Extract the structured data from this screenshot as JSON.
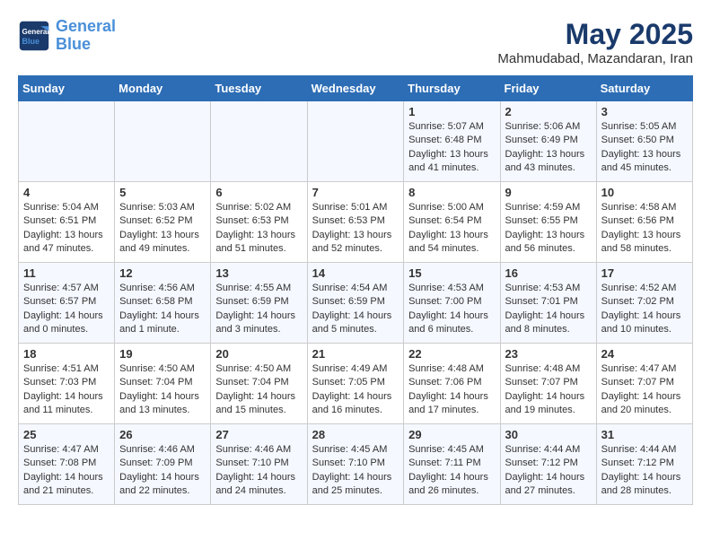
{
  "header": {
    "logo_line1": "General",
    "logo_line2": "Blue",
    "title": "May 2025",
    "subtitle": "Mahmudabad, Mazandaran, Iran"
  },
  "days_of_week": [
    "Sunday",
    "Monday",
    "Tuesday",
    "Wednesday",
    "Thursday",
    "Friday",
    "Saturday"
  ],
  "weeks": [
    [
      {
        "day": "",
        "info": ""
      },
      {
        "day": "",
        "info": ""
      },
      {
        "day": "",
        "info": ""
      },
      {
        "day": "",
        "info": ""
      },
      {
        "day": "1",
        "info": "Sunrise: 5:07 AM\nSunset: 6:48 PM\nDaylight: 13 hours and 41 minutes."
      },
      {
        "day": "2",
        "info": "Sunrise: 5:06 AM\nSunset: 6:49 PM\nDaylight: 13 hours and 43 minutes."
      },
      {
        "day": "3",
        "info": "Sunrise: 5:05 AM\nSunset: 6:50 PM\nDaylight: 13 hours and 45 minutes."
      }
    ],
    [
      {
        "day": "4",
        "info": "Sunrise: 5:04 AM\nSunset: 6:51 PM\nDaylight: 13 hours and 47 minutes."
      },
      {
        "day": "5",
        "info": "Sunrise: 5:03 AM\nSunset: 6:52 PM\nDaylight: 13 hours and 49 minutes."
      },
      {
        "day": "6",
        "info": "Sunrise: 5:02 AM\nSunset: 6:53 PM\nDaylight: 13 hours and 51 minutes."
      },
      {
        "day": "7",
        "info": "Sunrise: 5:01 AM\nSunset: 6:53 PM\nDaylight: 13 hours and 52 minutes."
      },
      {
        "day": "8",
        "info": "Sunrise: 5:00 AM\nSunset: 6:54 PM\nDaylight: 13 hours and 54 minutes."
      },
      {
        "day": "9",
        "info": "Sunrise: 4:59 AM\nSunset: 6:55 PM\nDaylight: 13 hours and 56 minutes."
      },
      {
        "day": "10",
        "info": "Sunrise: 4:58 AM\nSunset: 6:56 PM\nDaylight: 13 hours and 58 minutes."
      }
    ],
    [
      {
        "day": "11",
        "info": "Sunrise: 4:57 AM\nSunset: 6:57 PM\nDaylight: 14 hours and 0 minutes."
      },
      {
        "day": "12",
        "info": "Sunrise: 4:56 AM\nSunset: 6:58 PM\nDaylight: 14 hours and 1 minute."
      },
      {
        "day": "13",
        "info": "Sunrise: 4:55 AM\nSunset: 6:59 PM\nDaylight: 14 hours and 3 minutes."
      },
      {
        "day": "14",
        "info": "Sunrise: 4:54 AM\nSunset: 6:59 PM\nDaylight: 14 hours and 5 minutes."
      },
      {
        "day": "15",
        "info": "Sunrise: 4:53 AM\nSunset: 7:00 PM\nDaylight: 14 hours and 6 minutes."
      },
      {
        "day": "16",
        "info": "Sunrise: 4:53 AM\nSunset: 7:01 PM\nDaylight: 14 hours and 8 minutes."
      },
      {
        "day": "17",
        "info": "Sunrise: 4:52 AM\nSunset: 7:02 PM\nDaylight: 14 hours and 10 minutes."
      }
    ],
    [
      {
        "day": "18",
        "info": "Sunrise: 4:51 AM\nSunset: 7:03 PM\nDaylight: 14 hours and 11 minutes."
      },
      {
        "day": "19",
        "info": "Sunrise: 4:50 AM\nSunset: 7:04 PM\nDaylight: 14 hours and 13 minutes."
      },
      {
        "day": "20",
        "info": "Sunrise: 4:50 AM\nSunset: 7:04 PM\nDaylight: 14 hours and 15 minutes."
      },
      {
        "day": "21",
        "info": "Sunrise: 4:49 AM\nSunset: 7:05 PM\nDaylight: 14 hours and 16 minutes."
      },
      {
        "day": "22",
        "info": "Sunrise: 4:48 AM\nSunset: 7:06 PM\nDaylight: 14 hours and 17 minutes."
      },
      {
        "day": "23",
        "info": "Sunrise: 4:48 AM\nSunset: 7:07 PM\nDaylight: 14 hours and 19 minutes."
      },
      {
        "day": "24",
        "info": "Sunrise: 4:47 AM\nSunset: 7:07 PM\nDaylight: 14 hours and 20 minutes."
      }
    ],
    [
      {
        "day": "25",
        "info": "Sunrise: 4:47 AM\nSunset: 7:08 PM\nDaylight: 14 hours and 21 minutes."
      },
      {
        "day": "26",
        "info": "Sunrise: 4:46 AM\nSunset: 7:09 PM\nDaylight: 14 hours and 22 minutes."
      },
      {
        "day": "27",
        "info": "Sunrise: 4:46 AM\nSunset: 7:10 PM\nDaylight: 14 hours and 24 minutes."
      },
      {
        "day": "28",
        "info": "Sunrise: 4:45 AM\nSunset: 7:10 PM\nDaylight: 14 hours and 25 minutes."
      },
      {
        "day": "29",
        "info": "Sunrise: 4:45 AM\nSunset: 7:11 PM\nDaylight: 14 hours and 26 minutes."
      },
      {
        "day": "30",
        "info": "Sunrise: 4:44 AM\nSunset: 7:12 PM\nDaylight: 14 hours and 27 minutes."
      },
      {
        "day": "31",
        "info": "Sunrise: 4:44 AM\nSunset: 7:12 PM\nDaylight: 14 hours and 28 minutes."
      }
    ]
  ]
}
